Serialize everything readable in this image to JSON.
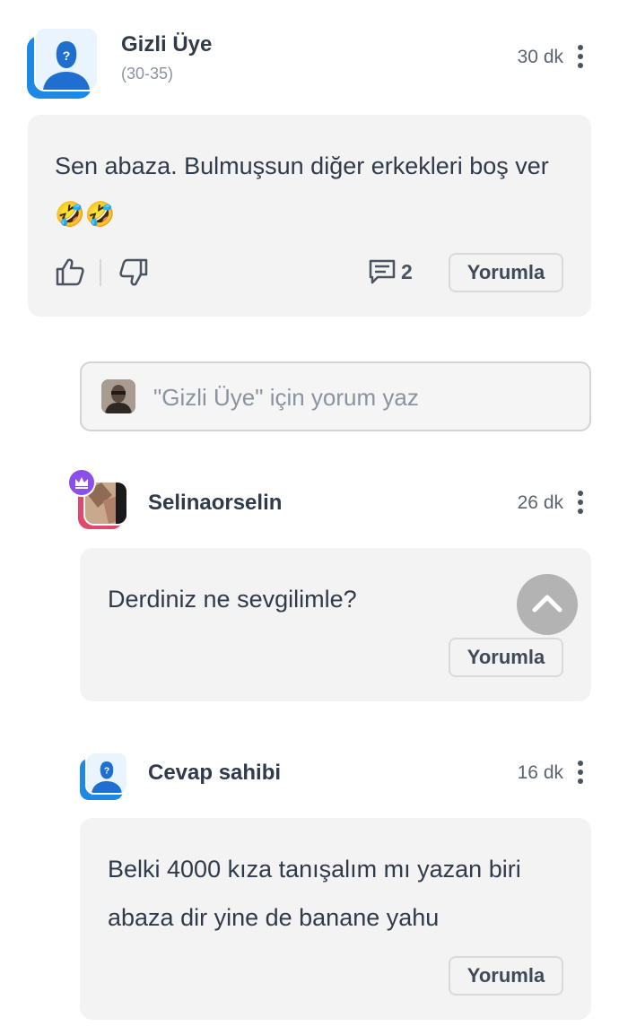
{
  "post": {
    "author": "Gizli Üye",
    "age_range": "(30-35)",
    "time": "30 dk",
    "text": "Sen abaza. Bulmuşsun diğer erkekleri boş ver 🤣🤣",
    "comment_count": "2",
    "reply_label": "Yorumla"
  },
  "reply_input": {
    "placeholder": "\"Gizli Üye\" için yorum yaz"
  },
  "replies": [
    {
      "author": "Selinaorselin",
      "time": "26 dk",
      "text": "Derdiniz ne sevgilimle?",
      "reply_label": "Yorumla"
    },
    {
      "author": "Cevap sahibi",
      "time": "16 dk",
      "text": "Belki 4000 kıza tanışalım mı yazan biri abaza dir yine de banane yahu",
      "reply_label": "Yorumla"
    }
  ],
  "colors": {
    "avatar_accent": "#1e88e5",
    "avatar_bg": "#eaf4ff",
    "premium_ring": "#e0496b",
    "premium_badge": "#8c4fe8",
    "card_bg": "#f3f3f3"
  },
  "icons": [
    "user-silhouette-icon",
    "more-vertical-icon",
    "thumbs-up-icon",
    "thumbs-down-icon",
    "comment-icon",
    "crown-icon",
    "chevron-up-icon"
  ]
}
